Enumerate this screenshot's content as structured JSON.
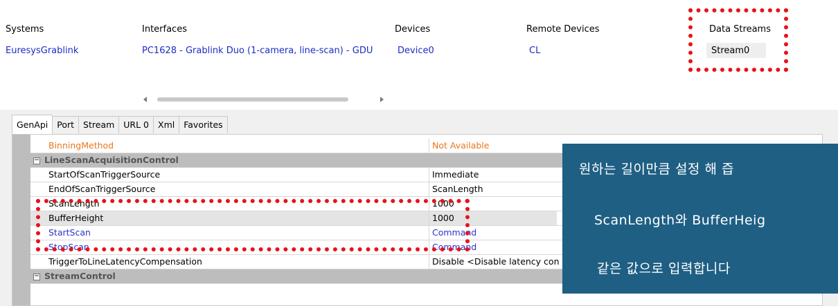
{
  "top": {
    "headers": {
      "systems": "Systems",
      "interfaces": "Interfaces",
      "devices": "Devices",
      "remote_devices": "Remote Devices",
      "data_streams": "Data Streams"
    },
    "values": {
      "system": "EuresysGrablink",
      "interface": "PC1628 - Grablink Duo (1-camera, line-scan) - GDU",
      "device": "Device0",
      "remote_device": "CL",
      "data_stream": "Stream0"
    }
  },
  "tabs": [
    "GenApi",
    "Port",
    "Stream",
    "URL 0",
    "Xml",
    "Favorites"
  ],
  "grid": {
    "rows": [
      {
        "name": "BinningMethod",
        "value": "Not Available",
        "style": "unavailable"
      },
      {
        "name": "LineScanAcquisitionControl",
        "value": "",
        "style": "category"
      },
      {
        "name": "StartOfScanTriggerSource",
        "value": "Immediate",
        "style": "normal"
      },
      {
        "name": "EndOfScanTriggerSource",
        "value": "ScanLength",
        "style": "normal"
      },
      {
        "name": "ScanLength",
        "value": "1000",
        "style": "normal"
      },
      {
        "name": "BufferHeight",
        "value": "1000",
        "style": "selected"
      },
      {
        "name": "StartScan",
        "value": "Command",
        "style": "command"
      },
      {
        "name": "StopScan",
        "value": "Command",
        "style": "command"
      },
      {
        "name": "TriggerToLineLatencyCompensation",
        "value": "Disable <Disable latency con",
        "style": "normal"
      },
      {
        "name": "StreamControl",
        "value": "",
        "style": "category"
      }
    ]
  },
  "overlay": {
    "lines": [
      "원하는 길이만큼 설정 해 즙",
      "ScanLength와 BufferHeig",
      "같은 값으로 입력합니다"
    ]
  },
  "colors": {
    "accent_red": "#e8121a",
    "link_blue": "#1a2cc4",
    "unavailable_orange": "#e8771d",
    "overlay_bg": "#1f5f84"
  },
  "icons": {
    "collapse": "collapse-minus-icon",
    "scroll_left": "scroll-left-arrow-icon",
    "scroll_right": "scroll-right-arrow-icon"
  }
}
